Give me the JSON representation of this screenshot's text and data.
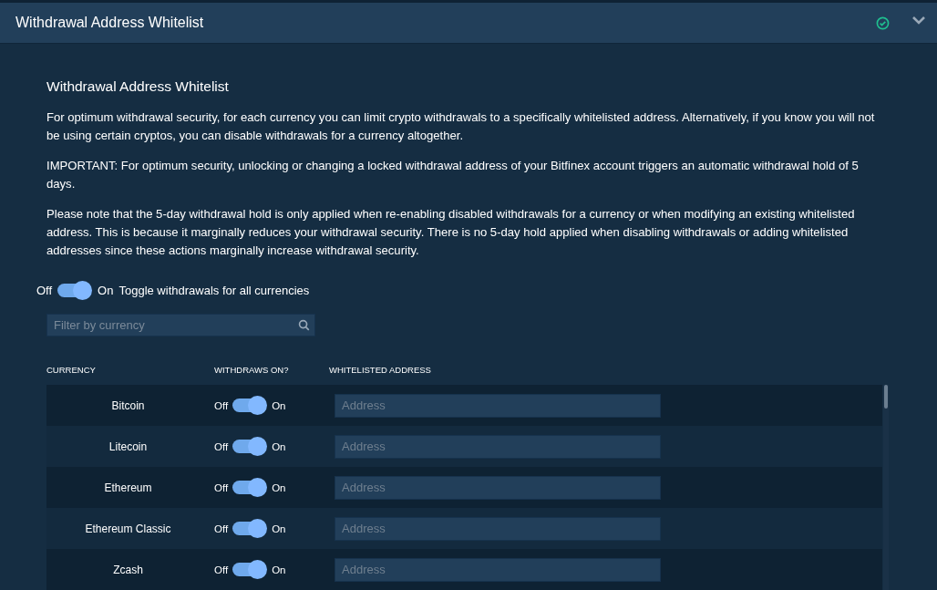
{
  "header": {
    "title": "Withdrawal Address Whitelist",
    "verified": true
  },
  "section_title": "Withdrawal Address Whitelist",
  "paragraphs": [
    "For optimum withdrawal security, for each currency you can limit crypto withdrawals to a specifically whitelisted address. Alternatively, if you know you will not be using certain cryptos, you can disable withdrawals for a currency altogether.",
    "IMPORTANT: For optimum security, unlocking or changing a locked withdrawal address of your Bitfinex account triggers an automatic withdrawal hold of 5 days.",
    "Please note that the 5-day withdrawal hold is only applied when re-enabling disabled withdrawals for a currency or when modifying an existing whitelisted address. This is because it marginally reduces your withdrawal security. There is no 5-day hold applied when disabling withdrawals or adding whitelisted addresses since these actions marginally increase withdrawal security."
  ],
  "master_toggle": {
    "off_label": "Off",
    "on_label": "On",
    "on": true,
    "label": "Toggle withdrawals for all currencies"
  },
  "filter": {
    "placeholder": "Filter by currency"
  },
  "table": {
    "columns": [
      "CURRENCY",
      "WITHDRAWS ON?",
      "WHITELISTED ADDRESS"
    ],
    "rows": [
      {
        "currency": "Bitcoin",
        "off_label": "Off",
        "on_label": "On",
        "on": true,
        "address_placeholder": "Address"
      },
      {
        "currency": "Litecoin",
        "off_label": "Off",
        "on_label": "On",
        "on": true,
        "address_placeholder": "Address"
      },
      {
        "currency": "Ethereum",
        "off_label": "Off",
        "on_label": "On",
        "on": true,
        "address_placeholder": "Address"
      },
      {
        "currency": "Ethereum Classic",
        "off_label": "Off",
        "on_label": "On",
        "on": true,
        "address_placeholder": "Address"
      },
      {
        "currency": "Zcash",
        "off_label": "Off",
        "on_label": "On",
        "on": true,
        "address_placeholder": "Address"
      }
    ]
  }
}
